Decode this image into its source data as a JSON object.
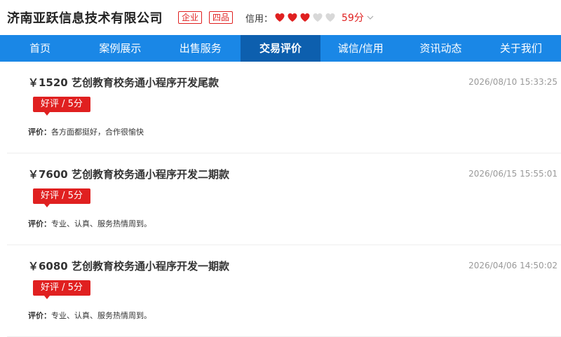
{
  "header": {
    "company": "济南亚跃信息技术有限公司",
    "tags": [
      "企业",
      "四品"
    ],
    "credit_label": "信用：",
    "hearts_filled": 3,
    "hearts_total": 5,
    "score": "59分"
  },
  "nav": {
    "items": [
      "首页",
      "案例展示",
      "出售服务",
      "交易评价",
      "诚信/信用",
      "资讯动态",
      "关于我们"
    ],
    "active_index": 3
  },
  "reviews": [
    {
      "title": "￥1520 艺创教育校务通小程序开发尾款",
      "time": "2026/08/10 15:33:25",
      "badge": "好评 / 5分",
      "comment_label": "评价：",
      "comment": "各方面都挺好，合作很愉快"
    },
    {
      "title": "￥7600 艺创教育校务通小程序开发二期款",
      "time": "2026/06/15 15:55:01",
      "badge": "好评 / 5分",
      "comment_label": "评价：",
      "comment": "专业、认真、服务热情周到。"
    },
    {
      "title": "￥6080 艺创教育校务通小程序开发一期款",
      "time": "2026/04/06 14:50:02",
      "badge": "好评 / 5分",
      "comment_label": "评价：",
      "comment": "专业、认真、服务热情周到。"
    }
  ],
  "colors": {
    "brand_red": "#e02020",
    "nav_blue": "#1a87e6",
    "nav_active": "#0d5fae"
  }
}
